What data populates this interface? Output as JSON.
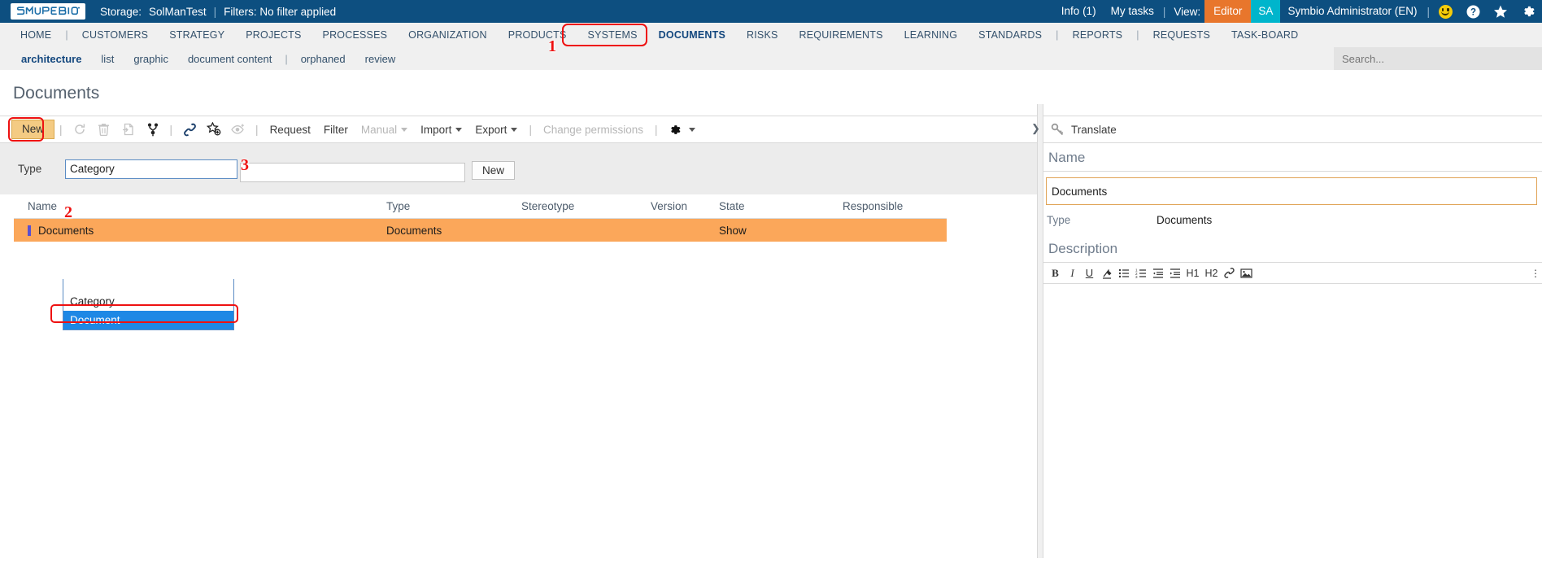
{
  "topbar": {
    "logo_text": "SYMBIO",
    "storage_label": "Storage:",
    "storage_value": "SolManTest",
    "sep": "|",
    "filters_text": "Filters: No filter applied",
    "info": "Info (1)",
    "my_tasks": "My tasks",
    "view_label": "View:",
    "view_value": "Editor",
    "avatar_initials": "SA",
    "user_name": "Symbio Administrator (EN)",
    "icons": {
      "smiley": "smiley-icon",
      "help": "help-icon",
      "favorites": "star-icon",
      "settings": "gear-icon"
    },
    "colors": {
      "bar": "#0d4f80",
      "editor_chip": "#e8762c",
      "avatar_chip": "#00b5cc"
    }
  },
  "mainnav": {
    "items": [
      {
        "label": "HOME",
        "active": false
      },
      {
        "label": "CUSTOMERS",
        "active": false
      },
      {
        "label": "STRATEGY",
        "active": false
      },
      {
        "label": "PROJECTS",
        "active": false
      },
      {
        "label": "PROCESSES",
        "active": false
      },
      {
        "label": "ORGANIZATION",
        "active": false
      },
      {
        "label": "PRODUCTS",
        "active": false
      },
      {
        "label": "SYSTEMS",
        "active": false
      },
      {
        "label": "DOCUMENTS",
        "active": true
      },
      {
        "label": "RISKS",
        "active": false
      },
      {
        "label": "REQUIREMENTS",
        "active": false
      },
      {
        "label": "LEARNING",
        "active": false
      },
      {
        "label": "STANDARDS",
        "active": false
      },
      {
        "label": "REPORTS",
        "active": false
      },
      {
        "label": "REQUESTS",
        "active": false
      },
      {
        "label": "TASK-BOARD",
        "active": false
      }
    ],
    "highlight_step": "1"
  },
  "subnav": {
    "items": [
      {
        "label": "architecture",
        "active": true
      },
      {
        "label": "list",
        "active": false
      },
      {
        "label": "graphic",
        "active": false
      },
      {
        "label": "document content",
        "active": false
      },
      {
        "label": "orphaned",
        "active": false
      },
      {
        "label": "review",
        "active": false
      }
    ],
    "search_placeholder": "Search...",
    "search_value": ""
  },
  "page": {
    "title": "Documents"
  },
  "toolbar": {
    "new_label": "New",
    "new_step": "2",
    "icons": [
      {
        "name": "refresh-icon",
        "disabled": true
      },
      {
        "name": "delete-icon",
        "disabled": true
      },
      {
        "name": "copy-icon",
        "disabled": true
      },
      {
        "name": "hierarchy-icon",
        "disabled": false
      },
      {
        "name": "link-icon",
        "disabled": false
      },
      {
        "name": "add-favorite-icon",
        "disabled": false
      },
      {
        "name": "watch-icon",
        "disabled": true
      }
    ],
    "request_label": "Request",
    "filter_label": "Filter",
    "manual_label": "Manual",
    "import_label": "Import",
    "export_label": "Export",
    "change_permissions_label": "Change permissions",
    "settings_icon": "gear-icon"
  },
  "new_form": {
    "type_label": "Type",
    "type_value": "Category",
    "name_value": "",
    "new_button_label": "New",
    "dropdown_step": "3",
    "dropdown_options": [
      {
        "label": "Category",
        "selected": false
      },
      {
        "label": "Document",
        "selected": true
      }
    ]
  },
  "table": {
    "columns": [
      "Name",
      "Type",
      "Stereotype",
      "Version",
      "State",
      "Responsible"
    ],
    "rows": [
      {
        "name": "Documents",
        "type": "Documents",
        "stereotype": "",
        "version": "",
        "state": "Show",
        "responsible": ""
      }
    ],
    "selected_row_color": "#fba75a"
  },
  "right_panel": {
    "key_icon": "key-icon",
    "translate_label": "Translate",
    "collapse_icon": "chevron-right-icon",
    "name_section_label": "Name",
    "name_value": "Documents",
    "type_label": "Type",
    "type_value": "Documents",
    "description_section_label": "Description",
    "editor_tools": [
      {
        "name": "bold-icon",
        "glyph": "B"
      },
      {
        "name": "italic-icon",
        "glyph": "I"
      },
      {
        "name": "underline-icon",
        "glyph": "U"
      },
      {
        "name": "clear-format-icon",
        "glyph": ""
      },
      {
        "name": "bullet-list-icon",
        "glyph": ""
      },
      {
        "name": "numbered-list-icon",
        "glyph": ""
      },
      {
        "name": "outdent-icon",
        "glyph": ""
      },
      {
        "name": "indent-icon",
        "glyph": ""
      },
      {
        "name": "heading-1-icon",
        "glyph": "H1"
      },
      {
        "name": "heading-2-icon",
        "glyph": "H2"
      },
      {
        "name": "insert-link-icon",
        "glyph": ""
      },
      {
        "name": "insert-image-icon",
        "glyph": ""
      }
    ],
    "editor_content": ""
  }
}
